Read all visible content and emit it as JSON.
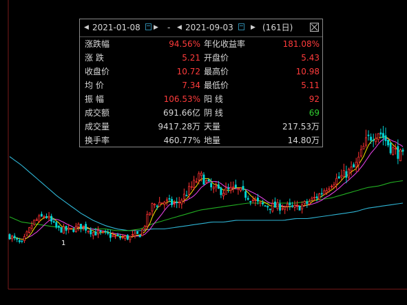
{
  "range": {
    "start_date": "2021-01-08",
    "end_date": "2021-09-03",
    "separator": "-",
    "days_text": "(161日)"
  },
  "stats": [
    {
      "l_label": "涨跌幅",
      "l_value": "94.56%",
      "l_color": "red",
      "r_label": "年化收益率",
      "r_value": "181.08%",
      "r_color": "red"
    },
    {
      "l_label": "涨  跌",
      "l_value": "5.21",
      "l_color": "red",
      "r_label": "开盘价",
      "r_value": "5.43",
      "r_color": "red"
    },
    {
      "l_label": "收盘价",
      "l_value": "10.72",
      "l_color": "red",
      "r_label": "最高价",
      "r_value": "10.98",
      "r_color": "red"
    },
    {
      "l_label": "均  价",
      "l_value": "7.34",
      "l_color": "red",
      "r_label": "最低价",
      "r_value": "5.11",
      "r_color": "red"
    },
    {
      "l_label": "振  幅",
      "l_value": "106.53%",
      "l_color": "red",
      "r_label": "阳  线",
      "r_value": "92",
      "r_color": "red"
    },
    {
      "l_label": "成交额",
      "l_value": "691.66亿",
      "l_color": "white",
      "r_label": "阴  线",
      "r_value": "69",
      "r_color": "green"
    },
    {
      "l_label": "成交量",
      "l_value": "9417.28万",
      "l_color": "white",
      "r_label": "天量",
      "r_value": "217.53万",
      "r_color": "white"
    },
    {
      "l_label": "换手率",
      "l_value": "460.77%",
      "l_color": "white",
      "r_label": "地量",
      "r_value": "14.80万",
      "r_color": "white"
    }
  ],
  "colors": {
    "up": "#ff3232",
    "down": "#00d4d4",
    "ma_yellow": "#e6d200",
    "ma_magenta": "#e040e0",
    "ma_green": "#22b022",
    "ma_cyan": "#2fb6d6"
  },
  "chart_data": {
    "type": "candlestick",
    "approx_series_shape": {
      "close": [
        6.1,
        5.6,
        6.9,
        7.3,
        6.5,
        6.4,
        6.7,
        6.3,
        6.2,
        6.0,
        6.0,
        6.2,
        7.9,
        8.1,
        7.9,
        8.7,
        9.6,
        8.8,
        8.7,
        8.8,
        8.4,
        7.9,
        7.8,
        7.8,
        7.7,
        8.0,
        8.5,
        9.2,
        9.6,
        10.1,
        11.7,
        12.2,
        11.2,
        10.7
      ],
      "long_ma_cyan": [
        10.7,
        10.2,
        9.6,
        9.0,
        8.4,
        7.9,
        7.4,
        7.0,
        6.7,
        6.5,
        6.4,
        6.4,
        6.5,
        6.5,
        6.6,
        6.7,
        6.8,
        6.9,
        6.9,
        7.0,
        7.0,
        7.0,
        7.0,
        7.0,
        7.1,
        7.1,
        7.2,
        7.3,
        7.4,
        7.5,
        7.7,
        7.8,
        7.9,
        8.0
      ],
      "ma_green": [
        7.2,
        6.9,
        6.8,
        6.7,
        6.6,
        6.5,
        6.5,
        6.5,
        6.5,
        6.4,
        6.4,
        6.5,
        6.8,
        7.0,
        7.2,
        7.4,
        7.6,
        7.7,
        7.8,
        7.9,
        8.0,
        8.0,
        8.0,
        8.0,
        8.0,
        8.1,
        8.2,
        8.3,
        8.5,
        8.7,
        8.9,
        9.0,
        9.2,
        9.3
      ]
    },
    "annotation": "1"
  }
}
